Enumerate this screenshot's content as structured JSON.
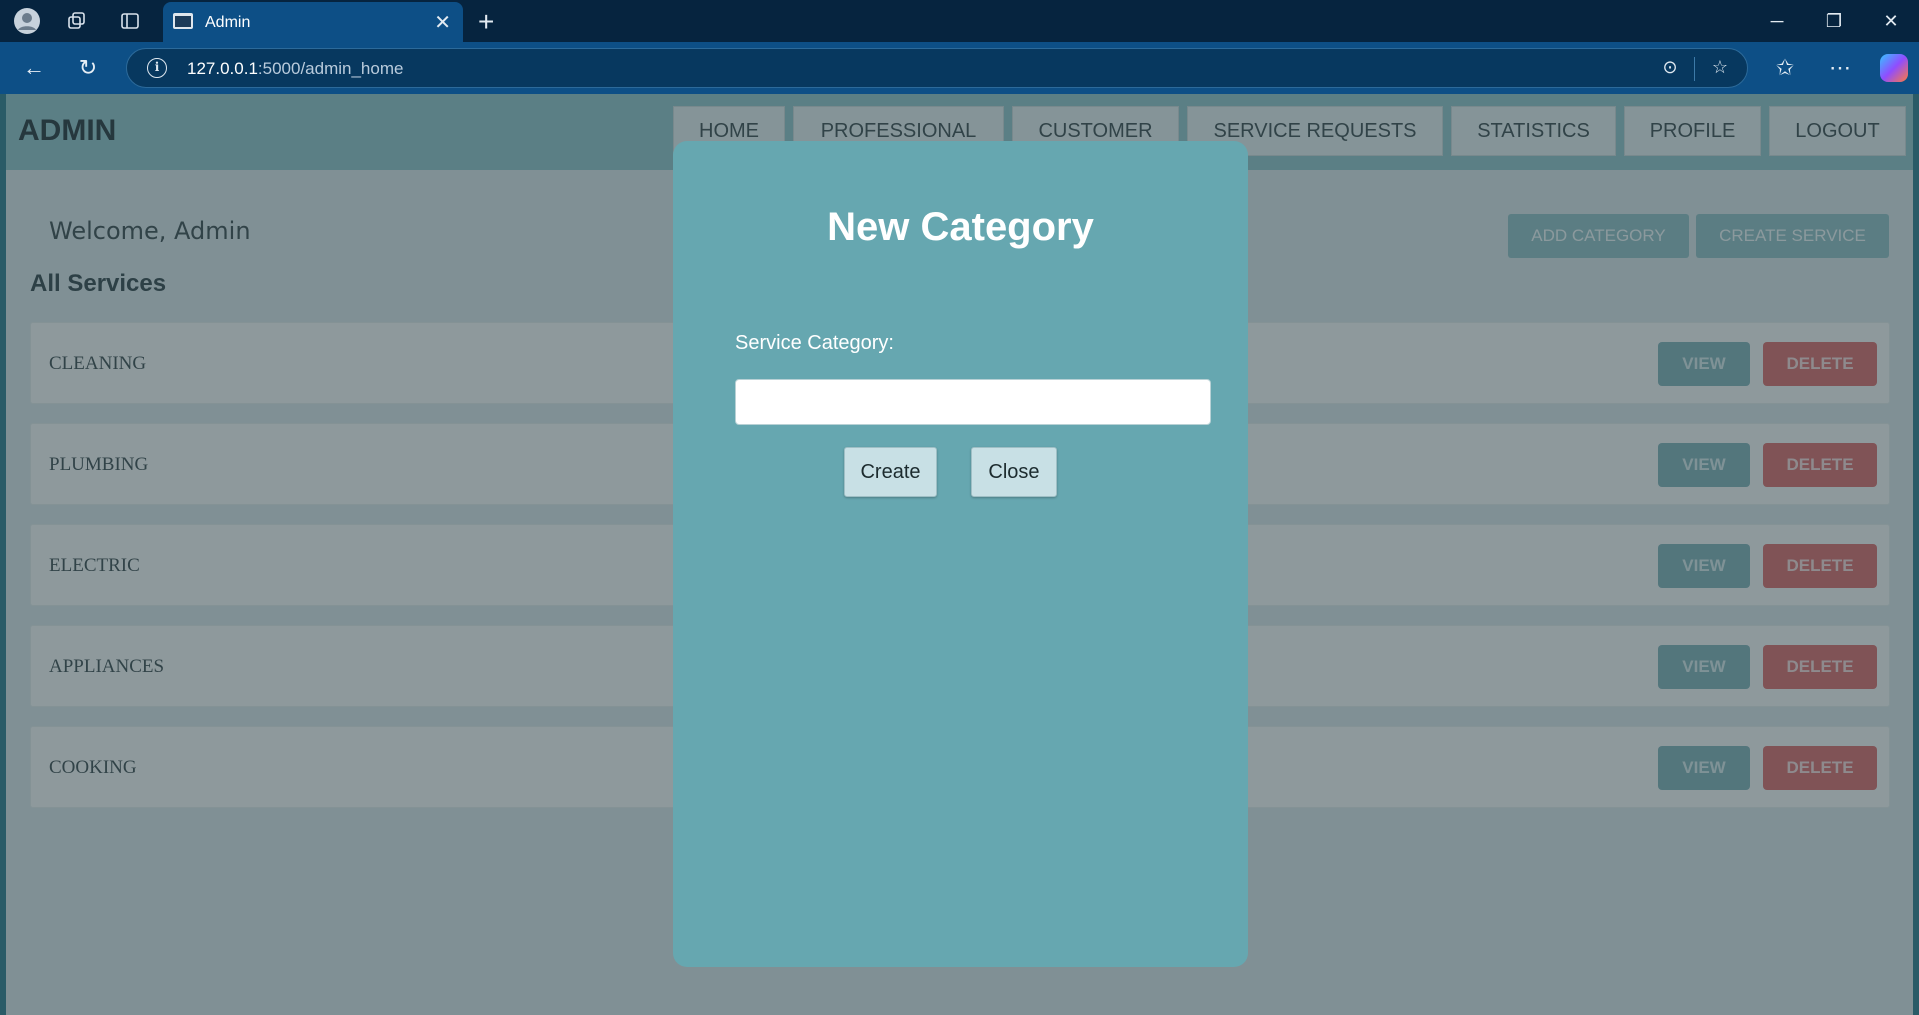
{
  "browser": {
    "tab_title": "Admin",
    "url_host": "127.0.0.1",
    "url_rest": ":5000/admin_home"
  },
  "header": {
    "brand": "ADMIN",
    "nav": [
      "HOME",
      "PROFESSIONAL",
      "CUSTOMER",
      "SERVICE REQUESTS",
      "STATISTICS",
      "PROFILE",
      "LOGOUT"
    ]
  },
  "main": {
    "welcome": "Welcome, Admin",
    "section_title": "All Services",
    "add_category_label": "ADD CATEGORY",
    "create_service_label": "CREATE SERVICE",
    "services": [
      {
        "name": "CLEANING",
        "view": "VIEW",
        "delete": "DELETE"
      },
      {
        "name": "PLUMBING",
        "view": "VIEW",
        "delete": "DELETE"
      },
      {
        "name": "ELECTRIC",
        "view": "VIEW",
        "delete": "DELETE"
      },
      {
        "name": "APPLIANCES",
        "view": "VIEW",
        "delete": "DELETE"
      },
      {
        "name": "COOKING",
        "view": "VIEW",
        "delete": "DELETE"
      }
    ]
  },
  "modal": {
    "title": "New Category",
    "label": "Service Category:",
    "input_value": "",
    "create_label": "Create",
    "close_label": "Close"
  },
  "colors": {
    "header_bg": "#8fc3c9",
    "modal_bg": "#66a7b0",
    "delete_red": "#d96a6a",
    "view_teal": "#7fb0b7"
  }
}
